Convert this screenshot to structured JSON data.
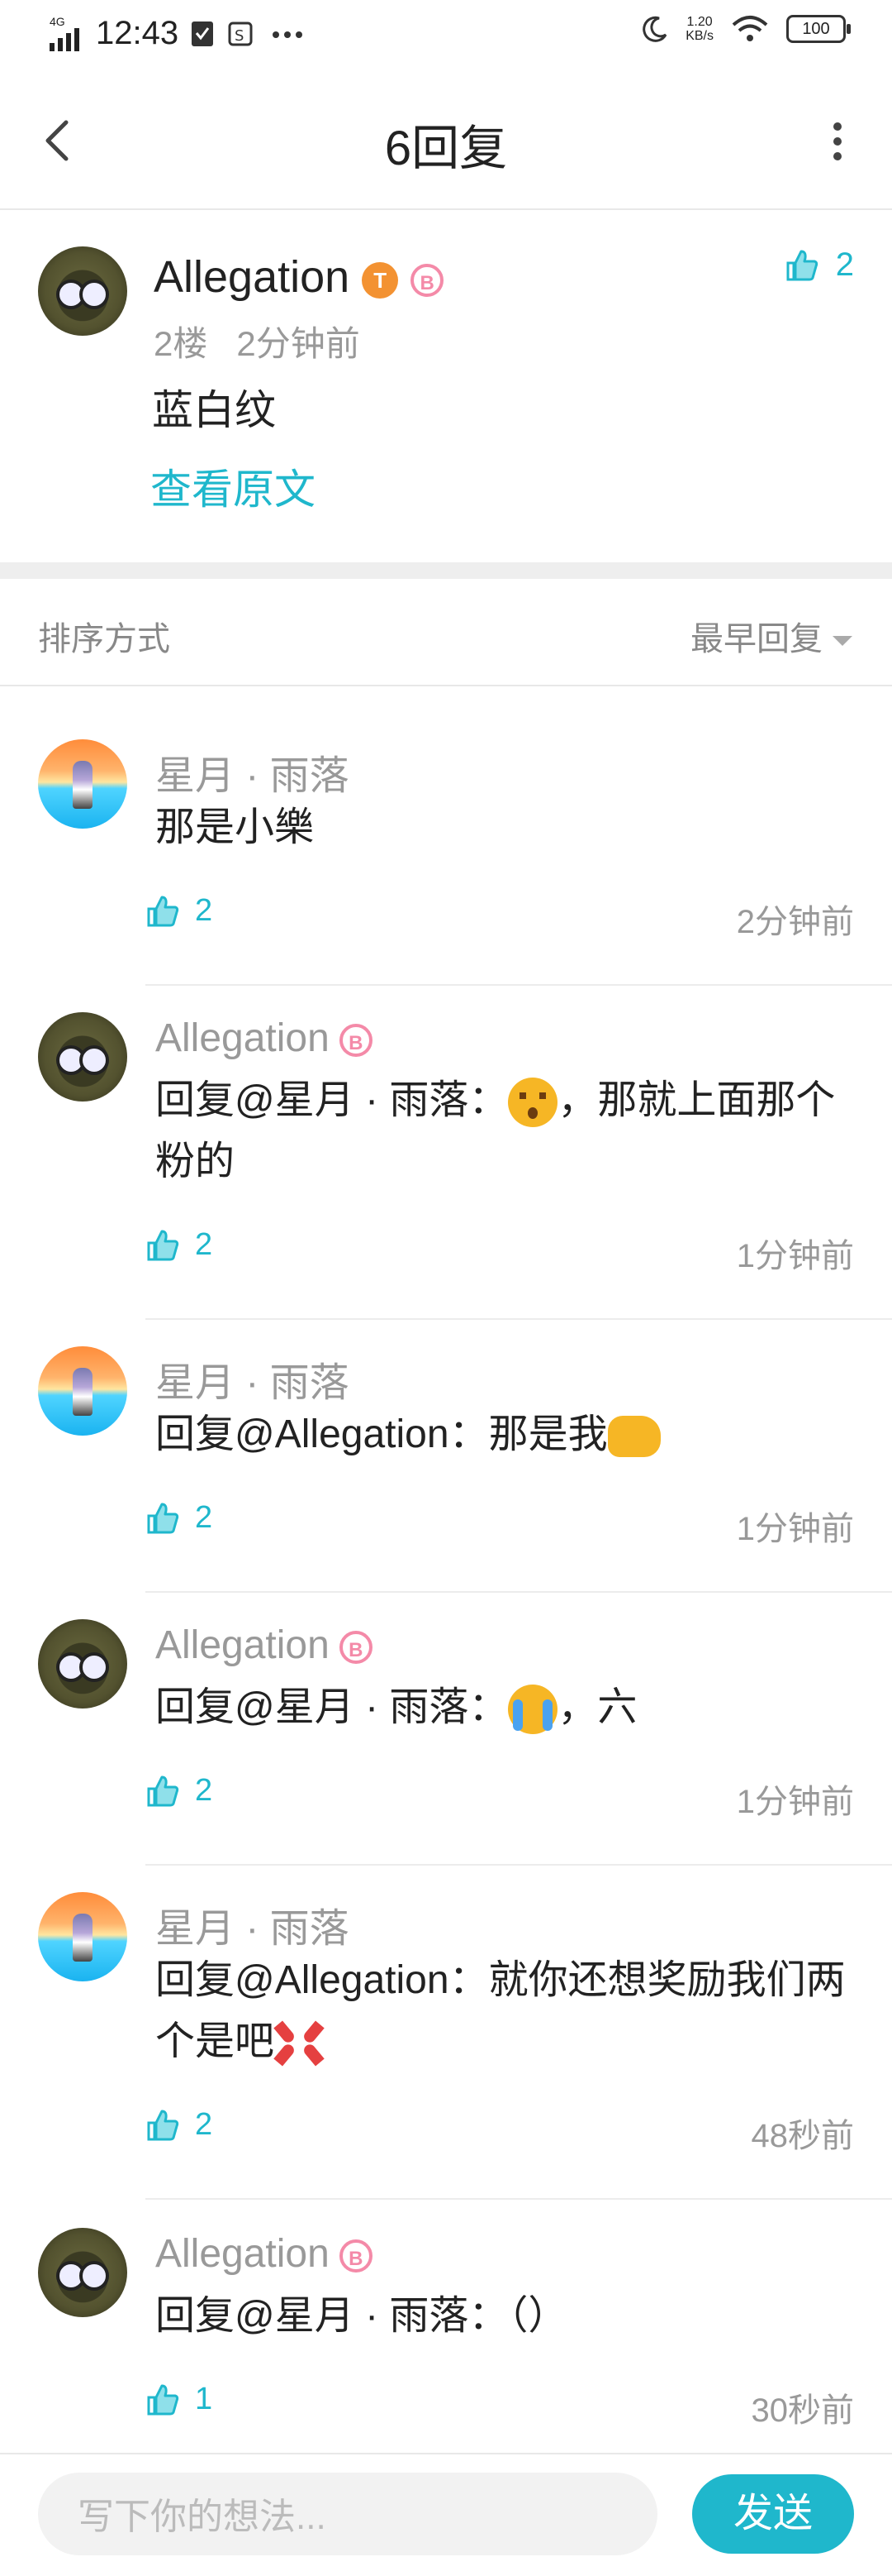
{
  "status_bar": {
    "network": "4G",
    "time": "12:43",
    "net_speed": "1.20",
    "net_unit": "KB/s",
    "battery": "100"
  },
  "header": {
    "title": "6回复"
  },
  "main_post": {
    "author": "Allegation",
    "floor": "2楼",
    "time": "2分钟前",
    "text": "蓝白纹",
    "view_original": "查看原文",
    "likes": "2",
    "badge_t": "T",
    "badge_b": "B"
  },
  "sort": {
    "label": "排序方式",
    "value": "最早回复"
  },
  "replies": [
    {
      "name": "星月 · 雨落",
      "text": "那是小樂",
      "likes": "2",
      "time": "2分钟前",
      "avatar": "girl"
    },
    {
      "name": "Allegation",
      "prefix": "回复",
      "at": "@星月 · 雨落",
      "colon": "：",
      "emoji": "surprise",
      "text": "，那就上面那个粉的",
      "likes": "2",
      "time": "1分钟前",
      "avatar": "owl"
    },
    {
      "name": "星月 · 雨落",
      "prefix": "回复",
      "at": "@Allegation",
      "colon": "：",
      "text": "那是我",
      "emoji": "fist",
      "likes": "2",
      "time": "1分钟前",
      "avatar": "girl"
    },
    {
      "name": "Allegation",
      "prefix": "回复",
      "at": "@星月 · 雨落",
      "colon": "：",
      "emoji": "cry",
      "text": "，六",
      "likes": "2",
      "time": "1分钟前",
      "avatar": "owl"
    },
    {
      "name": "星月 · 雨落",
      "prefix": "回复",
      "at": "@Allegation",
      "colon": "：",
      "text": "就你还想奖励我们两个是吧",
      "emoji": "anger",
      "likes": "2",
      "time": "48秒前",
      "avatar": "girl"
    },
    {
      "name": "Allegation",
      "prefix": "回复",
      "at": "@星月 · 雨落",
      "colon": "：",
      "text": "（）",
      "likes": "1",
      "time": "30秒前",
      "avatar": "owl"
    }
  ],
  "composer": {
    "placeholder": "写下你的想法...",
    "send_label": "发送"
  },
  "colors": {
    "accent": "#1fb7cc",
    "badge_pink": "#f48aa8",
    "badge_orange": "#f39232"
  }
}
